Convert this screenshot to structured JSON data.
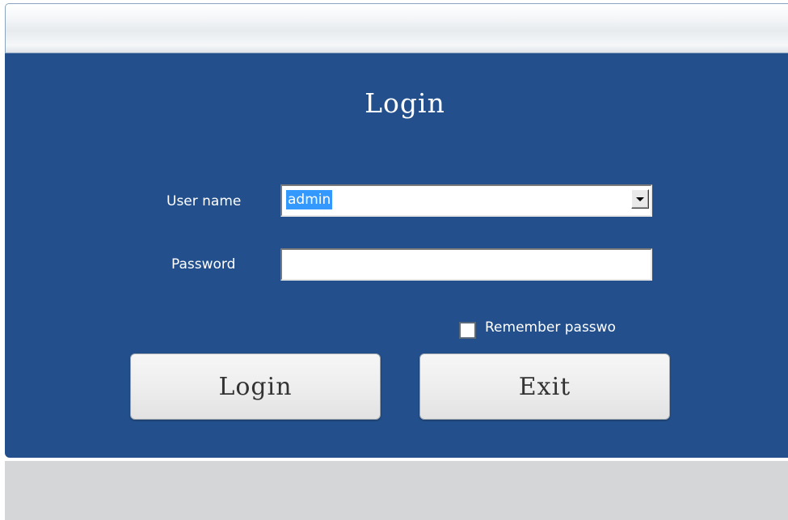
{
  "dialog": {
    "title": "Login",
    "username_label": "User name",
    "username_value": "admin",
    "password_label": "Password",
    "password_value": "",
    "remember_label": "Remember passwo",
    "remember_checked": false,
    "login_button": "Login",
    "exit_button": "Exit"
  },
  "colors": {
    "panel_background": "#23508c",
    "selection_highlight": "#3399ff",
    "bottom_area": "#d4d6d8"
  },
  "icons": {
    "dropdown": "chevron-down-icon"
  }
}
